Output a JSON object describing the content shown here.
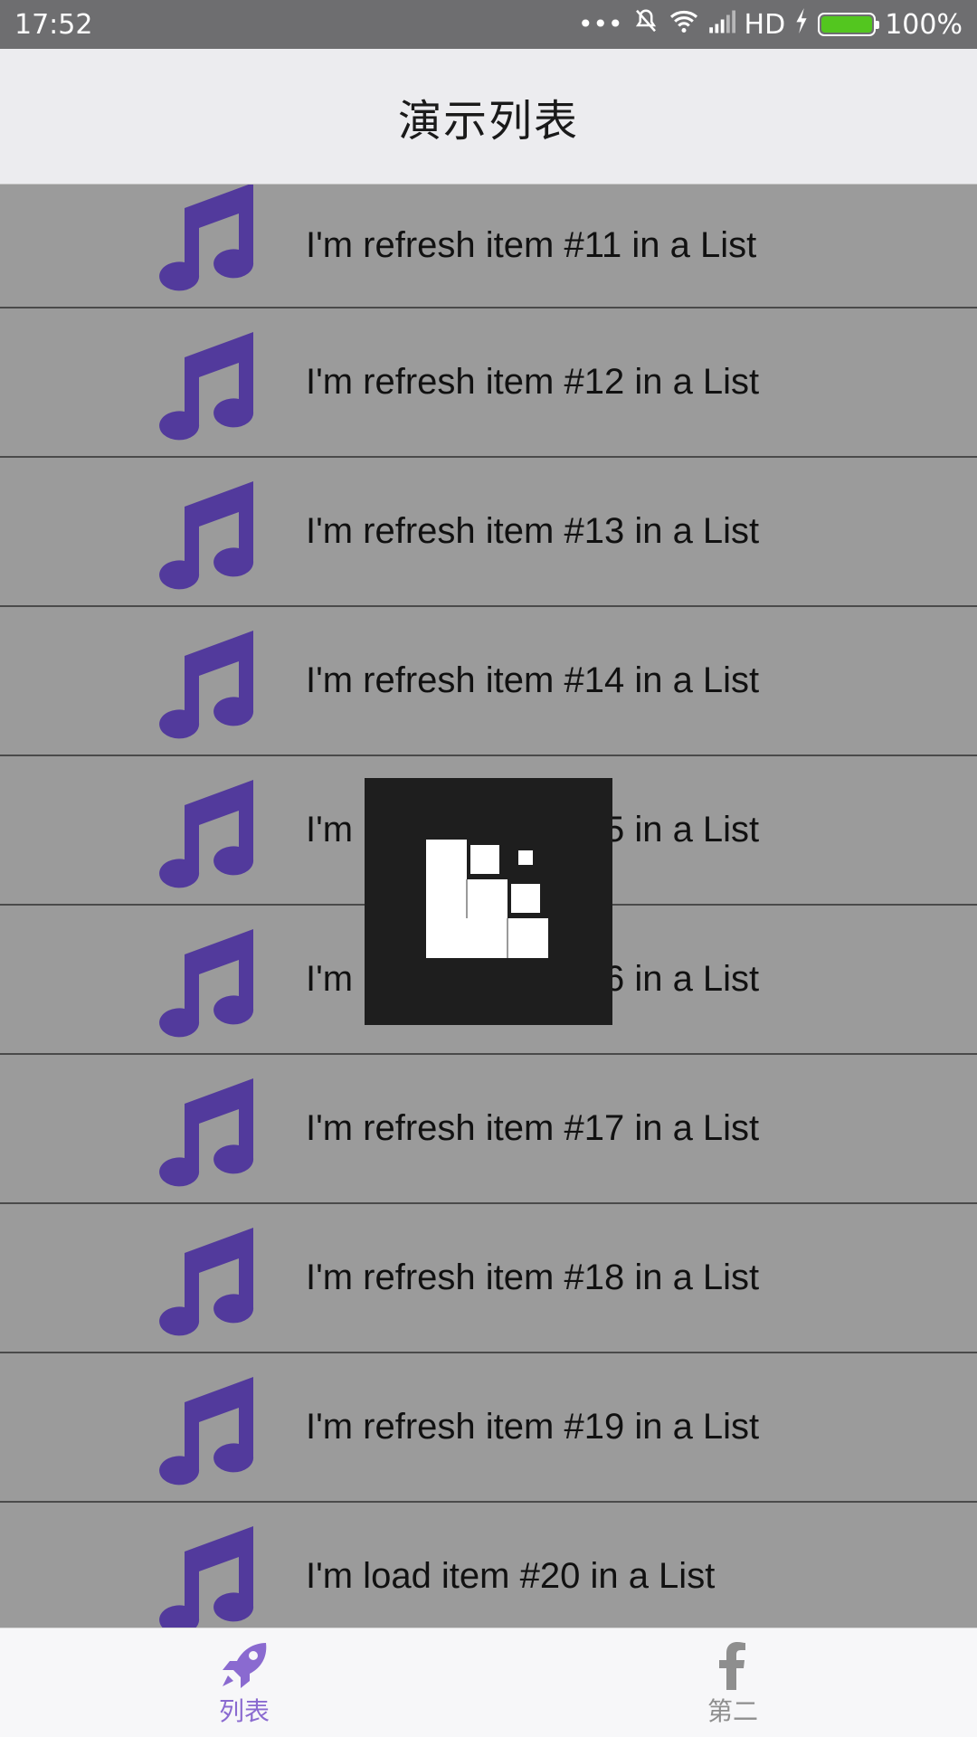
{
  "status_bar": {
    "time": "17:52",
    "network": "HD",
    "battery_percent": "100%",
    "icons": [
      "more-dots-icon",
      "mute-icon",
      "wifi-icon",
      "signal-icon",
      "charging-icon",
      "battery-icon"
    ]
  },
  "header": {
    "title": "演示列表"
  },
  "list": {
    "items": [
      {
        "label": "I'm refresh item #11 in a List",
        "icon": "music-note-icon"
      },
      {
        "label": "I'm refresh item #12 in a List",
        "icon": "music-note-icon"
      },
      {
        "label": "I'm refresh item #13 in a List",
        "icon": "music-note-icon"
      },
      {
        "label": "I'm refresh item #14 in a List",
        "icon": "music-note-icon"
      },
      {
        "label": "I'm refresh item #15 in a List",
        "icon": "music-note-icon"
      },
      {
        "label": "I'm refresh item #16 in a List",
        "icon": "music-note-icon"
      },
      {
        "label": "I'm refresh item #17 in a List",
        "icon": "music-note-icon"
      },
      {
        "label": "I'm refresh item #18 in a List",
        "icon": "music-note-icon"
      },
      {
        "label": "I'm refresh item #19 in a List",
        "icon": "music-note-icon"
      },
      {
        "label": "I'm load item #20 in a List",
        "icon": "music-note-icon"
      }
    ]
  },
  "loading": {
    "icon": "loading-blocks-icon"
  },
  "tabs": [
    {
      "label": "列表",
      "icon": "rocket-icon",
      "active": true
    },
    {
      "label": "第二",
      "icon": "facebook-icon",
      "active": false
    }
  ],
  "colors": {
    "accent": "#8a6ad0",
    "note_icon": "#523a9c",
    "list_background": "#9b9b9b",
    "status_bar": "#6e6e70",
    "header_background": "#ececef"
  }
}
